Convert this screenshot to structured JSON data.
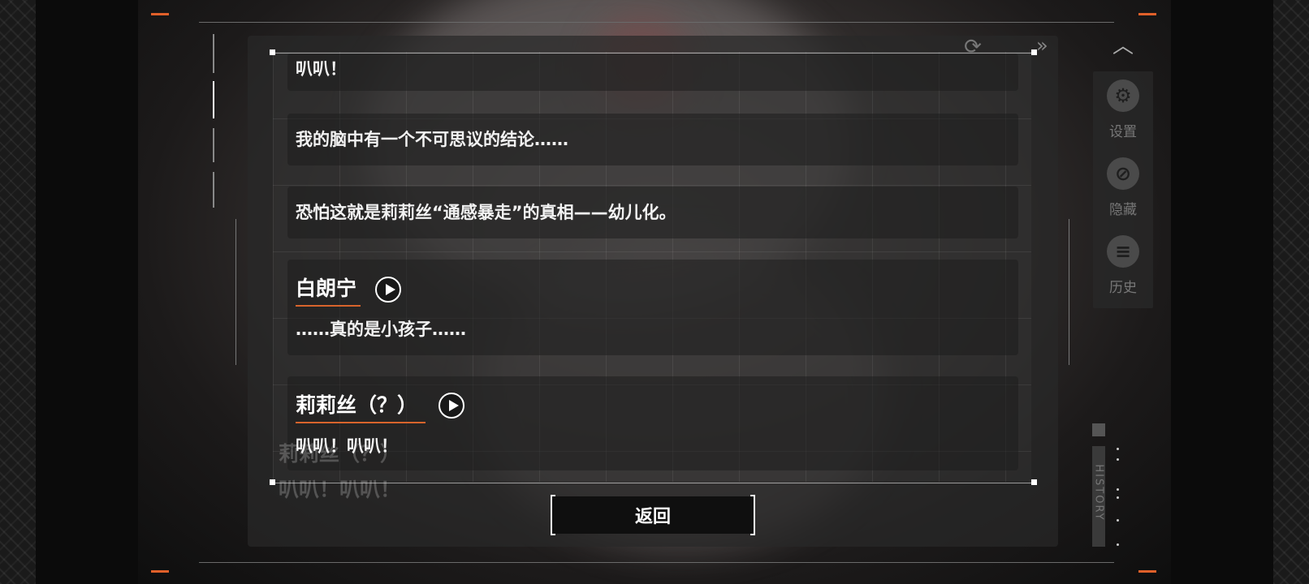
{
  "backlog": {
    "entries": [
      {
        "speaker": "",
        "text": "叭叭！"
      },
      {
        "speaker": "",
        "text": "我的脑中有一个不可思议的结论……"
      },
      {
        "speaker": "",
        "text": "恐怕这就是莉莉丝“通感暴走”的真相——幼儿化。"
      },
      {
        "speaker": "白朗宁",
        "text": "……真的是小孩子……"
      },
      {
        "speaker": "莉莉丝（？）",
        "text": "叭叭！叭叭！"
      }
    ],
    "current_line_speaker": "莉莉丝（？）",
    "current_line_text": "叭叭！叭叭！",
    "back_label": "返回"
  },
  "side_menu": {
    "items": [
      {
        "label": "设置",
        "icon": "gear-icon"
      },
      {
        "label": "隐藏",
        "icon": "eye-hidden-icon"
      },
      {
        "label": "历史",
        "icon": "chat-history-icon"
      }
    ],
    "history_tab": "HISTORY"
  },
  "colors": {
    "accent": "#e0602a",
    "panel": "#282828"
  }
}
